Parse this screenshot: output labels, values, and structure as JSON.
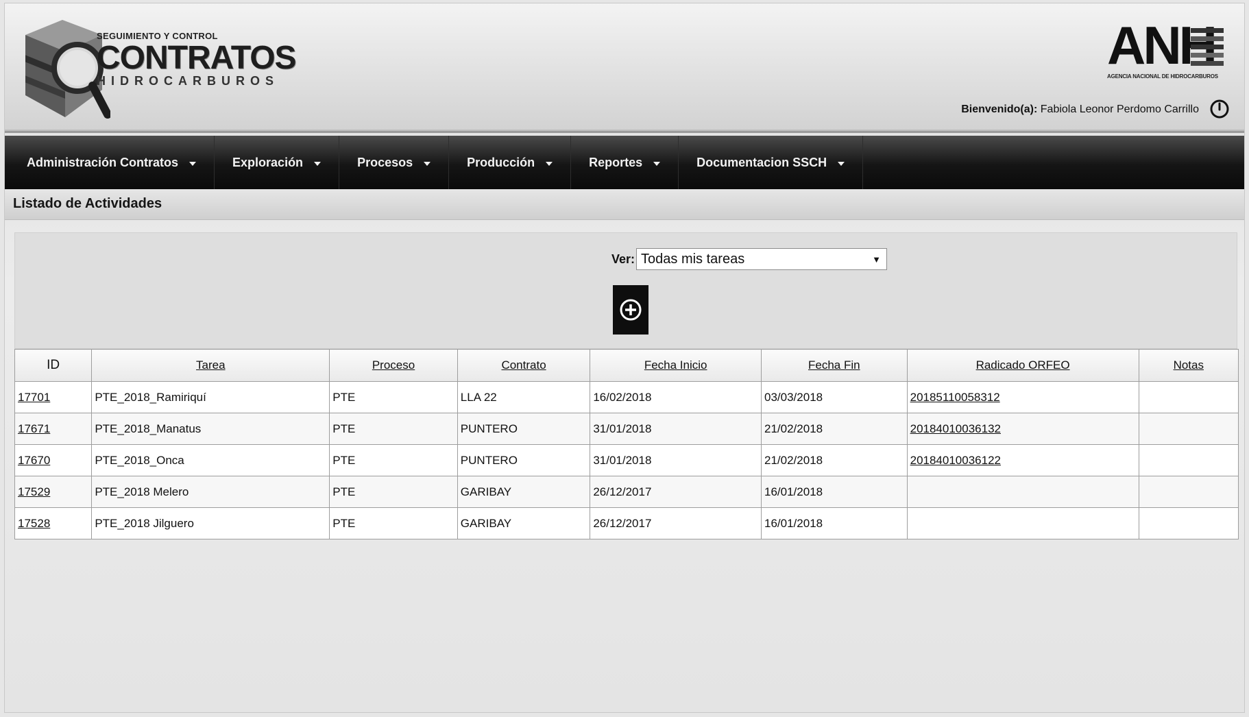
{
  "header": {
    "logo_small": "SEGUIMIENTO Y CONTROL",
    "logo_big": "CONTRATOS",
    "logo_sub": "HIDROCARBUROS",
    "anh_letters": "ANH",
    "anh_caption": "AGENCIA NACIONAL DE HIDROCARBUROS",
    "welcome_label": "Bienvenido(a):",
    "user_name": "Fabiola Leonor Perdomo Carrillo",
    "power_icon": "power-icon"
  },
  "menu": {
    "items": [
      {
        "label": "Administración Contratos"
      },
      {
        "label": "Exploración"
      },
      {
        "label": "Procesos"
      },
      {
        "label": "Producción"
      },
      {
        "label": "Reportes"
      },
      {
        "label": "Documentacion SSCH"
      }
    ]
  },
  "page": {
    "title": "Listado de Actividades"
  },
  "filter": {
    "label": "Ver:",
    "selected": "Todas mis tareas",
    "add_icon": "plus-circle-icon"
  },
  "table": {
    "columns": [
      "ID",
      "Tarea",
      "Proceso",
      "Contrato",
      "Fecha Inicio",
      "Fecha Fin",
      "Radicado ORFEO",
      "Notas"
    ],
    "rows": [
      {
        "id": "17701",
        "tarea": "PTE_2018_Ramiriquí",
        "proceso": "PTE",
        "contrato": "LLA 22",
        "fecha_inicio": "16/02/2018",
        "fecha_fin": "03/03/2018",
        "radicado": "20185110058312",
        "notas": ""
      },
      {
        "id": "17671",
        "tarea": "PTE_2018_Manatus",
        "proceso": "PTE",
        "contrato": "PUNTERO",
        "fecha_inicio": "31/01/2018",
        "fecha_fin": "21/02/2018",
        "radicado": "20184010036132",
        "notas": ""
      },
      {
        "id": "17670",
        "tarea": "PTE_2018_Onca",
        "proceso": "PTE",
        "contrato": "PUNTERO",
        "fecha_inicio": "31/01/2018",
        "fecha_fin": "21/02/2018",
        "radicado": "20184010036122",
        "notas": ""
      },
      {
        "id": "17529",
        "tarea": "PTE_2018 Melero",
        "proceso": "PTE",
        "contrato": "GARIBAY",
        "fecha_inicio": "26/12/2017",
        "fecha_fin": "16/01/2018",
        "radicado": "",
        "notas": ""
      },
      {
        "id": "17528",
        "tarea": "PTE_2018 Jilguero",
        "proceso": "PTE",
        "contrato": "GARIBAY",
        "fecha_inicio": "26/12/2017",
        "fecha_fin": "16/01/2018",
        "radicado": "",
        "notas": ""
      }
    ]
  }
}
